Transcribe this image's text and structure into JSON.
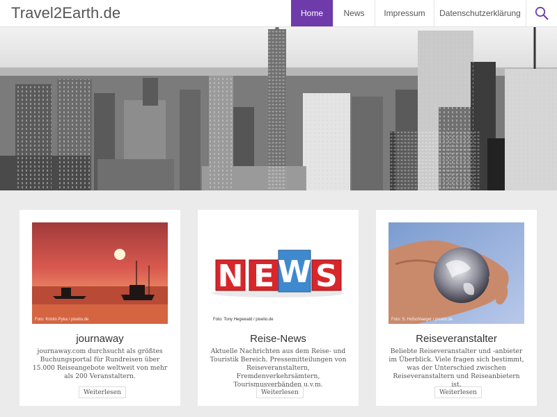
{
  "header": {
    "site_title": "Travel2Earth.de",
    "nav": [
      {
        "label": "Home",
        "active": true
      },
      {
        "label": "News",
        "active": false
      },
      {
        "label": "Impressum",
        "active": false
      },
      {
        "label": "Datenschutzerklärung",
        "active": false
      }
    ],
    "search_icon": "search-icon",
    "accent_color": "#6f3bab"
  },
  "hero": {
    "image": "new-york-skyline-black-and-white"
  },
  "cards": [
    {
      "image": "sunset-boats-on-sea",
      "credit": "Foto: Kristin Pyka / pixelio.de",
      "title": "journaway",
      "text": "journaway.com durchsucht als größtes Buchungsportal für Rundreisen über 15.000 Reiseangebote weltweit von mehr als 200 Veranstaltern.",
      "button": "Weiterlesen"
    },
    {
      "image": "news-letters",
      "credit": "Foto: Tony Hegewald / pixelio.de",
      "title": "Reise-News",
      "text": "Aktuelle Nachrichten aus dem Reise- und Touristik Bereich. Pressemitteilungen von Reiseveranstaltern, Fremdenverkehrsämtern, Tourismusverbänden u.v.m.",
      "button": "Weiterlesen",
      "news_letters": [
        "N",
        "E",
        "W",
        "S"
      ]
    },
    {
      "image": "hand-holding-glass-globe",
      "credit": "Foto: S. Hofschlaeger / pixelio.de",
      "title": "Reiseveranstalter",
      "text": "Beliebte Reiseveranstalter und -anbieter im Überblick. Viele fragen sich bestimmt, was der Unterschied zwischen Reiseveranstaltern und Reiseanbietern ist.",
      "button": "Weiterlesen"
    }
  ]
}
